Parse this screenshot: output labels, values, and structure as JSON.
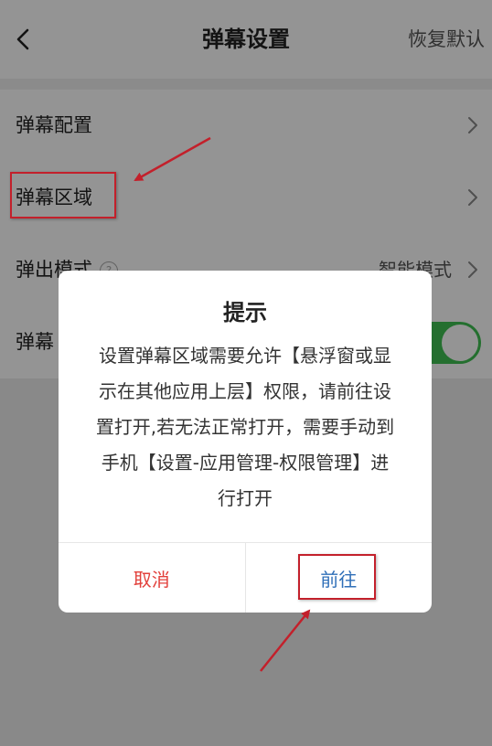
{
  "header": {
    "title": "弹幕设置",
    "restore_default": "恢复默认"
  },
  "settings": {
    "items": [
      {
        "label": "弹幕配置"
      },
      {
        "label": "弹幕区域"
      },
      {
        "label": "弹出模式",
        "value": "智能模式"
      },
      {
        "label": "弹幕"
      }
    ]
  },
  "dialog": {
    "title": "提示",
    "message_lines": [
      "设置弹幕区域需要允许【悬浮窗或显",
      "示在其他应用上层】权限，请前往设",
      "置打开,若无法正常打开，需要手动到",
      "手机【设置-应用管理-权限管理】进",
      "行打开"
    ],
    "cancel_label": "取消",
    "confirm_label": "前往"
  },
  "colors": {
    "toggle_on": "#3fc052",
    "cancel": "#e2403b",
    "confirm": "#2f6fb8",
    "annotation": "#c3202b"
  },
  "icons": {
    "back": "chevron-left-icon",
    "row_arrow": "chevron-right-icon",
    "help": "question-circle-icon"
  }
}
